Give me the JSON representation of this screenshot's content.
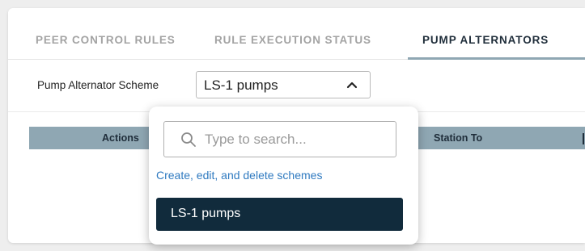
{
  "tabs": [
    {
      "label": "PEER CONTROL RULES",
      "active": false
    },
    {
      "label": "RULE EXECUTION STATUS",
      "active": false
    },
    {
      "label": "PUMP ALTERNATORS",
      "active": true
    }
  ],
  "scheme": {
    "label": "Pump Alternator Scheme",
    "selected": "LS-1 pumps",
    "chevron_icon": "chevron-up-icon"
  },
  "table": {
    "columns": [
      "Actions",
      "Station To"
    ]
  },
  "dropdown": {
    "search_placeholder": "Type to search...",
    "search_value": "",
    "search_icon": "search-icon",
    "manage_link": "Create, edit, and delete schemes",
    "options": [
      "LS-1 pumps"
    ]
  },
  "colors": {
    "accent": "#8fa7b3",
    "option_selected_bg": "#112b3c",
    "link": "#2f7ac0"
  }
}
